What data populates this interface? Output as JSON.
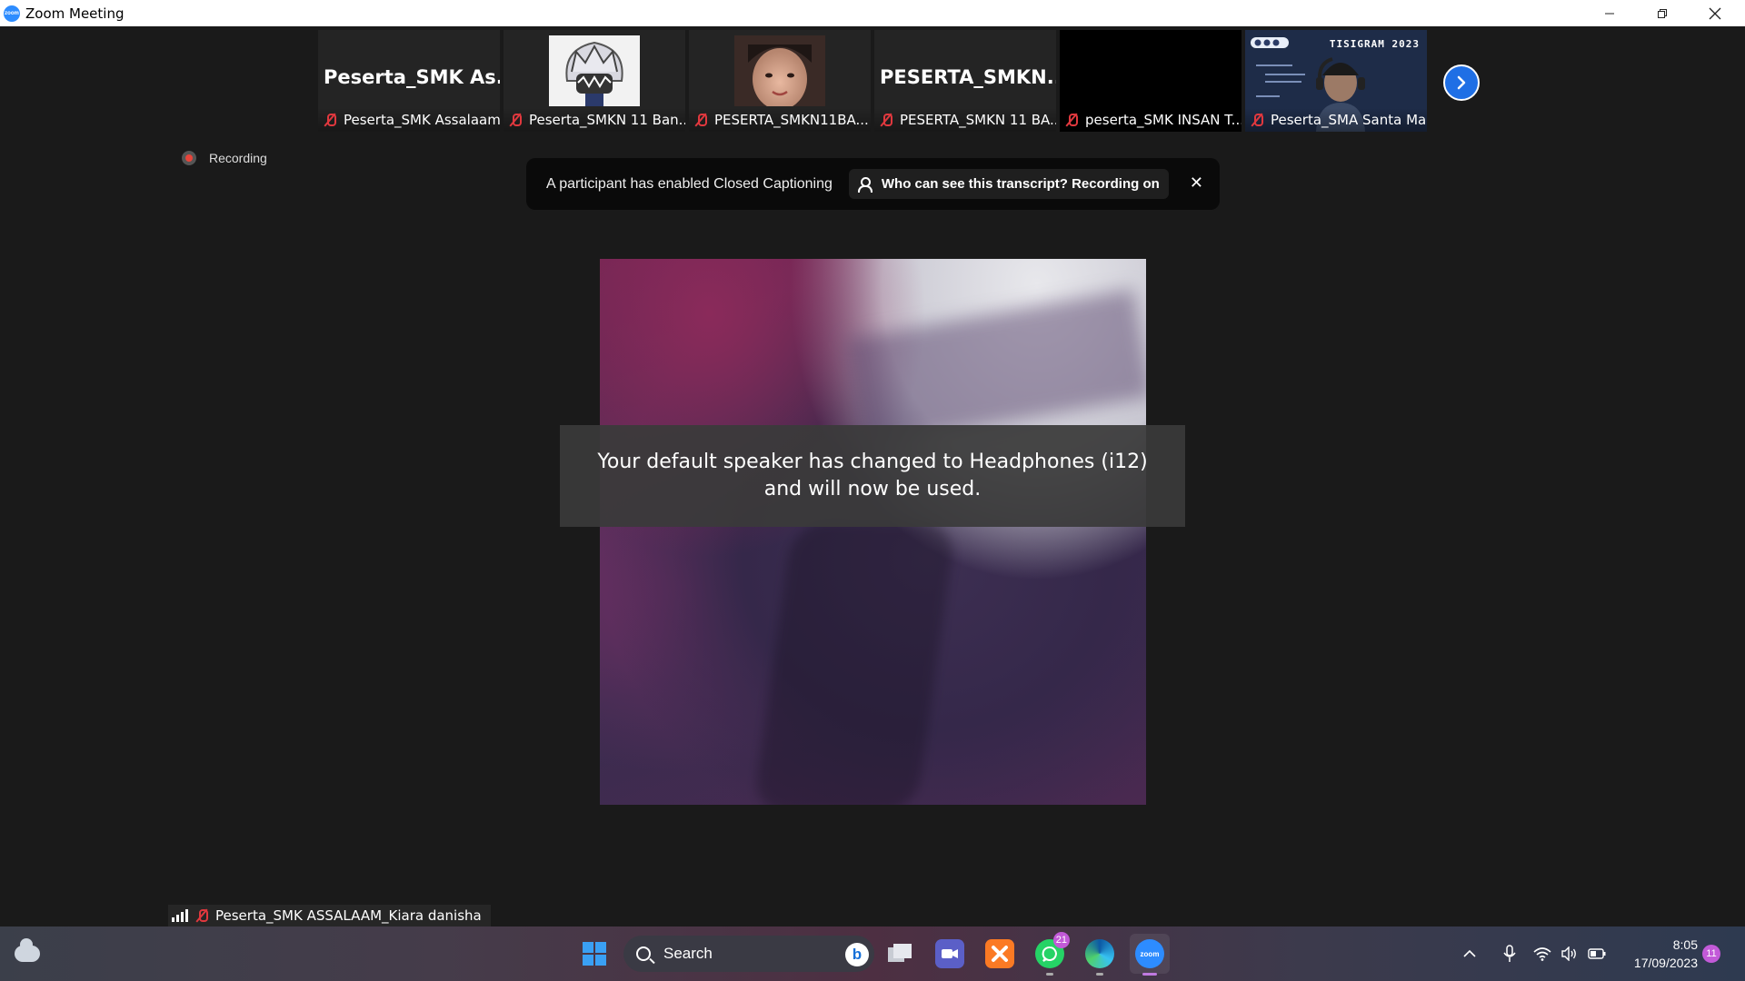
{
  "window": {
    "title": "Zoom Meeting",
    "app_icon_text": "zoom"
  },
  "participants": [
    {
      "display_name": "Peserta_SMK  As...",
      "label": "Peserta_SMK Assalaam...",
      "video": "name"
    },
    {
      "display_name": "",
      "label": "Peserta_SMKN 11 Ban...",
      "video": "avatar-anime"
    },
    {
      "display_name": "",
      "label": "PESERTA_SMKN11BA...",
      "video": "avatar-photo"
    },
    {
      "display_name": "PESERTA_SMKN...",
      "label": "PESERTA_SMKN 11 BA...",
      "video": "name"
    },
    {
      "display_name": "",
      "label": "peserta_SMK INSAN T...",
      "video": "black"
    },
    {
      "display_name": "",
      "label": "Peserta_SMA Santa Ma...",
      "video": "presenter",
      "slide_title": "TISIGRAM 2023"
    }
  ],
  "recording": {
    "label": "Recording"
  },
  "caption_banner": {
    "message": "A participant has enabled Closed Captioning",
    "transcript_button": "Who can see this transcript? Recording on"
  },
  "notice": {
    "text": "Your default speaker has changed to Headphones (i12) and will now be used."
  },
  "active_speaker": {
    "label": "Peserta_SMK ASSALAAM_Kiara danisha"
  },
  "taskbar": {
    "search_placeholder": "Search",
    "whatsapp_badge": "21",
    "zoom_label": "zoom",
    "time": "8:05",
    "date": "17/09/2023",
    "notification_count": "11"
  },
  "colors": {
    "zoom_blue": "#2d8cff",
    "mute_red": "#e0383e",
    "recording_red": "#e8443a"
  }
}
